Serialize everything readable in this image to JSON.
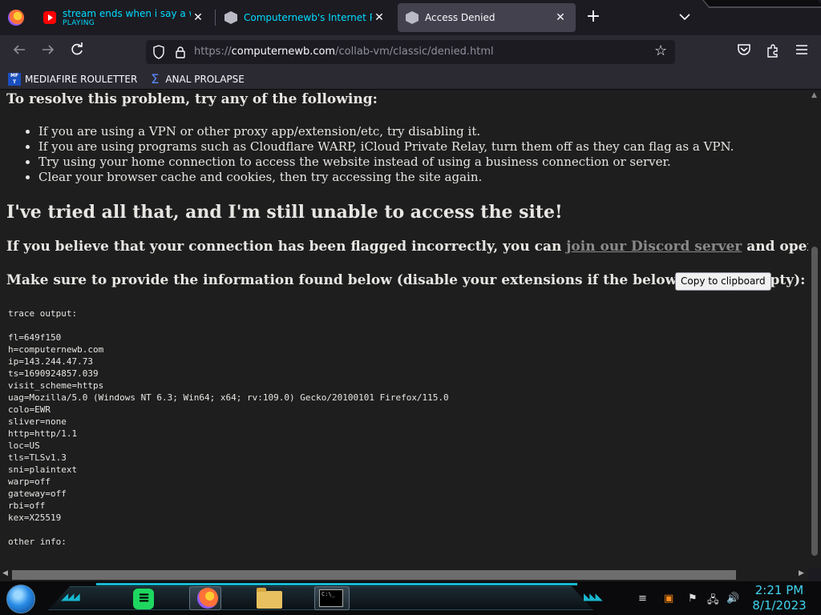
{
  "browser": {
    "tabs": [
      {
        "title": "stream ends when i say a word",
        "subtitle": "PLAYING",
        "favicon": "youtube-icon"
      },
      {
        "title": "Computernewb's Internet Pub",
        "favicon": "collabvm-icon"
      },
      {
        "title": "Access Denied",
        "favicon": "page-icon",
        "active": true
      }
    ],
    "new_tab": "+",
    "tab_list": "⌄",
    "url": {
      "scheme": "https://",
      "domain": "computernewb.com",
      "path": "/collab-vm/classic/denied.html"
    },
    "bookmarks": [
      {
        "label": "MEDIAFIRE ROULETTER",
        "icon": "mediafire-icon",
        "icon_text": "MF T"
      },
      {
        "label": "ANAL PROLAPSE",
        "icon": "sigma-icon"
      }
    ]
  },
  "page": {
    "heading_resolve": "To resolve this problem, try any of the following:",
    "tips": [
      "If you are using a VPN or other proxy app/extension/etc, try disabling it.",
      "If you are using programs such as Cloudflare WARP, iCloud Private Relay, turn them off as they can flag as a VPN.",
      "Try using your home connection to access the website instead of using a business connection or server.",
      "Clear your browser cache and cookies, then try accessing the site again."
    ],
    "heading_tried": "I've tried all that, and I'm still unable to access the site!",
    "flag_pre": "If you believe that your connection has been flagged incorrectly, you can ",
    "flag_link": "join our Discord server",
    "flag_post": " and open a ticket.",
    "info_text": "Make sure to provide the information found below (disable your extensions if the below space is empty):",
    "copy_button": "Copy to clipboard",
    "trace_output": "trace output:\n\nfl=649f150\nh=computernewb.com\nip=143.244.47.73\nts=1690924857.039\nvisit_scheme=https\nuag=Mozilla/5.0 (Windows NT 6.3; Win64; x64; rv:109.0) Gecko/20100101 Firefox/115.0\ncolo=EWR\nsliver=none\nhttp=http/1.1\nloc=US\ntls=TLSv1.3\nsni=plaintext\nwarp=off\ngateway=off\nrbi=off\nkex=X25519\n\nother info:"
  },
  "taskbar": {
    "cmd_label": "C:\\_",
    "time": "2:21 PM",
    "date": "8/1/2023",
    "accent": "#18b8d0"
  }
}
